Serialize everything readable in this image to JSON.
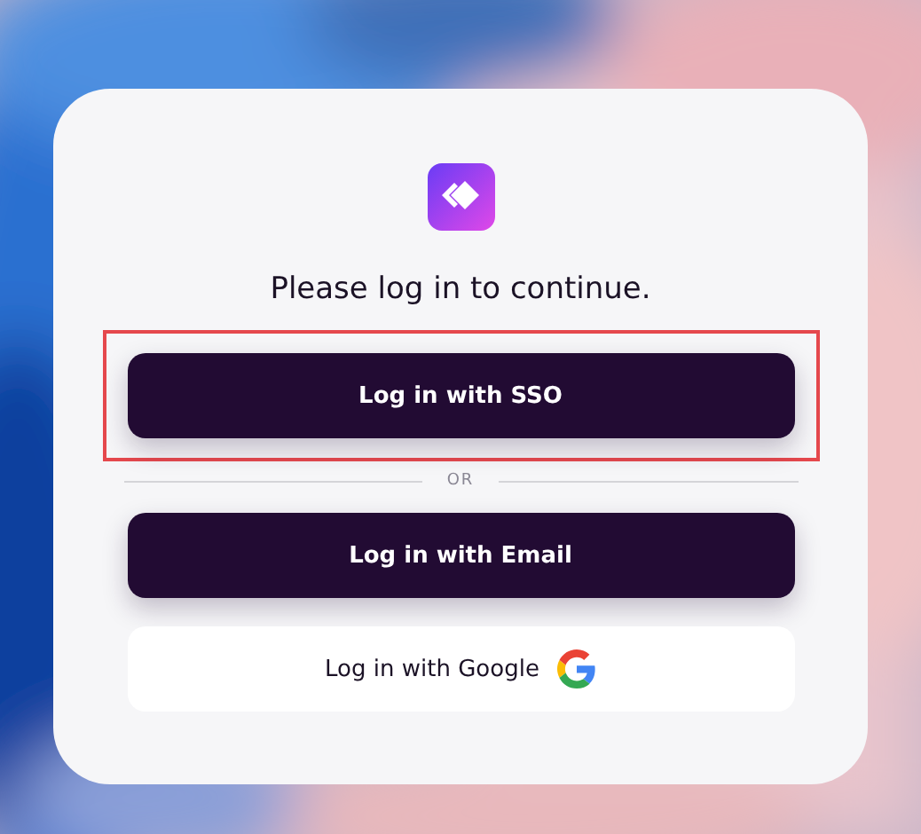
{
  "card": {
    "heading": "Please log in to continue.",
    "buttons": [
      {
        "label": "Log in with SSO",
        "kind": "dark",
        "highlighted": true
      },
      {
        "divider": "OR"
      },
      {
        "label": "Log in with Email",
        "kind": "dark",
        "highlighted": false
      },
      {
        "label": "Log in with Google",
        "kind": "google",
        "highlighted": false
      }
    ]
  }
}
